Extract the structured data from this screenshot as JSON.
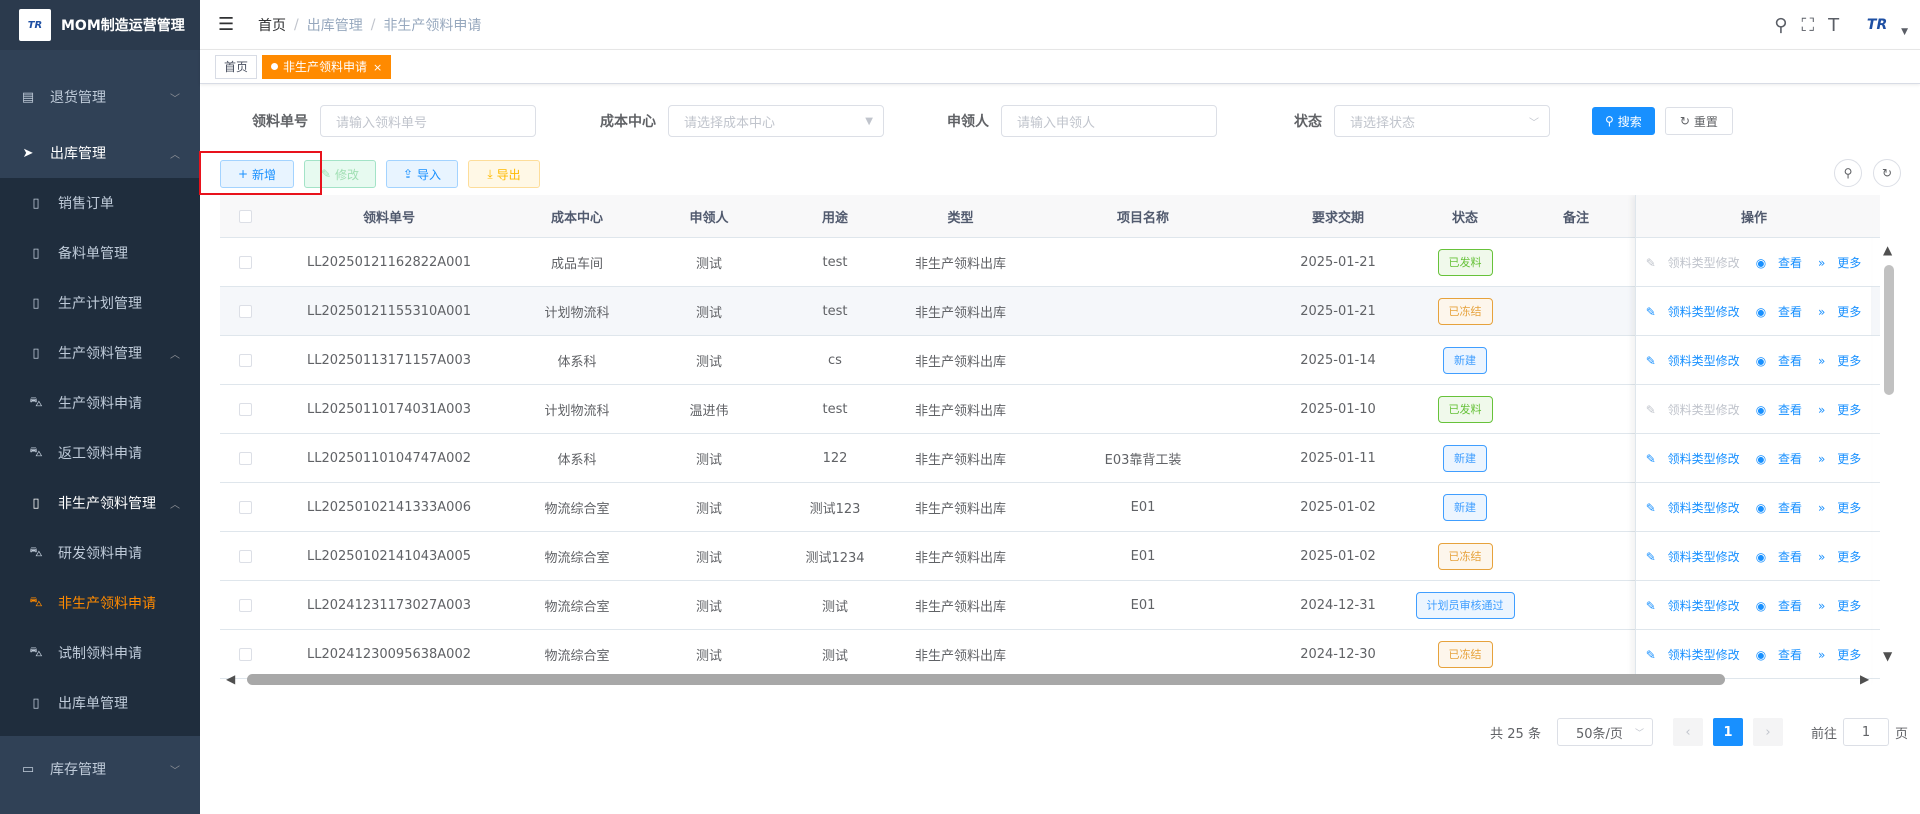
{
  "app": {
    "title": "MOM制造运营管理",
    "logo_text": "TR"
  },
  "sidebar": {
    "items": [
      {
        "label": "退货管理",
        "icon": "clipboard-icon",
        "level": 1
      },
      {
        "label": "出库管理",
        "icon": "send-icon",
        "level": 1
      },
      {
        "label": "销售订单",
        "icon": "book-icon",
        "level": 2
      },
      {
        "label": "备料单管理",
        "icon": "book-icon",
        "level": 2
      },
      {
        "label": "生产计划管理",
        "icon": "book-icon",
        "level": 2
      },
      {
        "label": "生产领料管理",
        "icon": "book-icon",
        "level": 2
      },
      {
        "label": "生产领料申请",
        "icon": "car-icon",
        "level": 2
      },
      {
        "label": "返工领料申请",
        "icon": "car-icon",
        "level": 2
      },
      {
        "label": "非生产领料管理",
        "icon": "book-icon",
        "level": 2
      },
      {
        "label": "研发领料申请",
        "icon": "car-icon",
        "level": 2
      },
      {
        "label": "非生产领料申请",
        "icon": "car-icon",
        "level": 2
      },
      {
        "label": "试制领料申请",
        "icon": "car-icon",
        "level": 2
      },
      {
        "label": "出库单管理",
        "icon": "book-icon",
        "level": 2
      },
      {
        "label": "库存管理",
        "icon": "monitor-icon",
        "level": 1
      }
    ]
  },
  "breadcrumb": {
    "home": "首页",
    "section": "出库管理",
    "current": "非生产领料申请"
  },
  "tags": {
    "home": "首页",
    "active": "非生产领料申请",
    "close": "×"
  },
  "search": {
    "code_label": "领料单号",
    "code_placeholder": "请输入领料单号",
    "cost_label": "成本中心",
    "cost_placeholder": "请选择成本中心",
    "applicant_label": "申领人",
    "applicant_placeholder": "请输入申领人",
    "status_label": "状态",
    "status_placeholder": "请选择状态",
    "search_btn": "搜索",
    "reset_btn": "重置"
  },
  "toolbar": {
    "add": "新增",
    "edit": "修改",
    "import": "导入",
    "export": "导出"
  },
  "table": {
    "headers": [
      "领料单号",
      "成本中心",
      "申领人",
      "用途",
      "类型",
      "项目名称",
      "要求交期",
      "状态",
      "备注",
      "操作"
    ],
    "rows": [
      {
        "code": "LL20250121162822A001",
        "cost": "成品车间",
        "applicant": "测试",
        "usage": "test",
        "type": "非生产领料出库",
        "project": "",
        "date": "2025-01-21",
        "status": "已发料",
        "status_color": "green",
        "edit_disabled": true
      },
      {
        "code": "LL20250121155310A001",
        "cost": "计划物流科",
        "applicant": "测试",
        "usage": "test",
        "type": "非生产领料出库",
        "project": "",
        "date": "2025-01-21",
        "status": "已冻结",
        "status_color": "orange",
        "edit_disabled": false
      },
      {
        "code": "LL20250113171157A003",
        "cost": "体系科",
        "applicant": "测试",
        "usage": "cs",
        "type": "非生产领料出库",
        "project": "",
        "date": "2025-01-14",
        "status": "新建",
        "status_color": "blue",
        "edit_disabled": false
      },
      {
        "code": "LL20250110174031A003",
        "cost": "计划物流科",
        "applicant": "温进伟",
        "usage": "test",
        "type": "非生产领料出库",
        "project": "",
        "date": "2025-01-10",
        "status": "已发料",
        "status_color": "green",
        "edit_disabled": true
      },
      {
        "code": "LL20250110104747A002",
        "cost": "体系科",
        "applicant": "测试",
        "usage": "122",
        "type": "非生产领料出库",
        "project": "E03靠背工装",
        "date": "2025-01-11",
        "status": "新建",
        "status_color": "blue",
        "edit_disabled": false
      },
      {
        "code": "LL20250102141333A006",
        "cost": "物流综合室",
        "applicant": "测试",
        "usage": "测试123",
        "type": "非生产领料出库",
        "project": "E01",
        "date": "2025-01-02",
        "status": "新建",
        "status_color": "blue",
        "edit_disabled": false
      },
      {
        "code": "LL20250102141043A005",
        "cost": "物流综合室",
        "applicant": "测试",
        "usage": "测试1234",
        "type": "非生产领料出库",
        "project": "E01",
        "date": "2025-01-02",
        "status": "已冻结",
        "status_color": "orange",
        "edit_disabled": false
      },
      {
        "code": "LL20241231173027A003",
        "cost": "物流综合室",
        "applicant": "测试",
        "usage": "测试",
        "type": "非生产领料出库",
        "project": "E01",
        "date": "2024-12-31",
        "status": "计划员审核通过",
        "status_color": "blue",
        "edit_disabled": false
      },
      {
        "code": "LL20241230095638A002",
        "cost": "物流综合室",
        "applicant": "测试",
        "usage": "测试",
        "type": "非生产领料出库",
        "project": "",
        "date": "2024-12-30",
        "status": "已冻结",
        "status_color": "orange",
        "edit_disabled": false
      }
    ],
    "op_edit": "领料类型修改",
    "op_view": "查看",
    "op_more": "更多"
  },
  "pager": {
    "total": "共 25 条",
    "page_size": "50条/页",
    "current": "1",
    "goto_label": "前往",
    "goto_value": "1",
    "page_unit": "页"
  },
  "colors": {
    "sidebar_bg": "#304156",
    "accent": "#ff8a00",
    "primary": "#1890ff",
    "highlight": "#e8121c"
  }
}
